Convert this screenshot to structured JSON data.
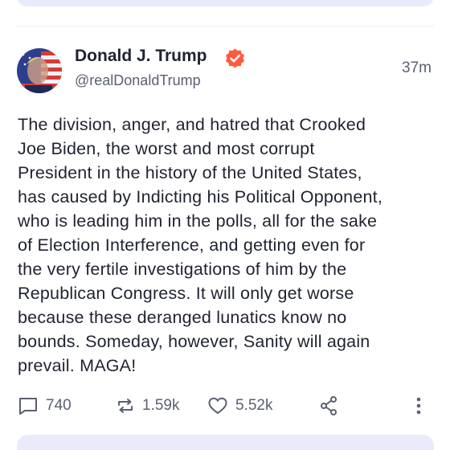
{
  "post": {
    "author": {
      "name": "Donald J. Trump",
      "handle": "@realDonaldTrump",
      "verified": true,
      "avatar_icon": "avatar-portrait-flag"
    },
    "timestamp": "37m",
    "text_lines": [
      "The division, anger, and hatred that Crooked",
      "Joe Biden, the worst and most corrupt",
      "President in the history of the United States,",
      "has caused by Indicting his Political Opponent,",
      "who is leading him in the polls, all for the sake",
      "of Election Interference, and getting even for",
      "the very fertile investigations of him by the",
      "Republican Congress. It will only get worse",
      "because these deranged lunatics know no",
      "bounds. Someday, however, Sanity will again",
      "prevail. MAGA!"
    ],
    "actions": {
      "replies": "740",
      "reposts": "1.59k",
      "likes": "5.52k",
      "reply_icon": "comment-icon",
      "repost_icon": "repost-icon",
      "like_icon": "heart-icon",
      "share_icon": "share-icon",
      "more_icon": "more-vertical-icon"
    }
  },
  "colors": {
    "text": "#1f2330",
    "muted": "#5b6070",
    "verified": "#ff5a3c",
    "card_bg": "#e9ebfb"
  }
}
